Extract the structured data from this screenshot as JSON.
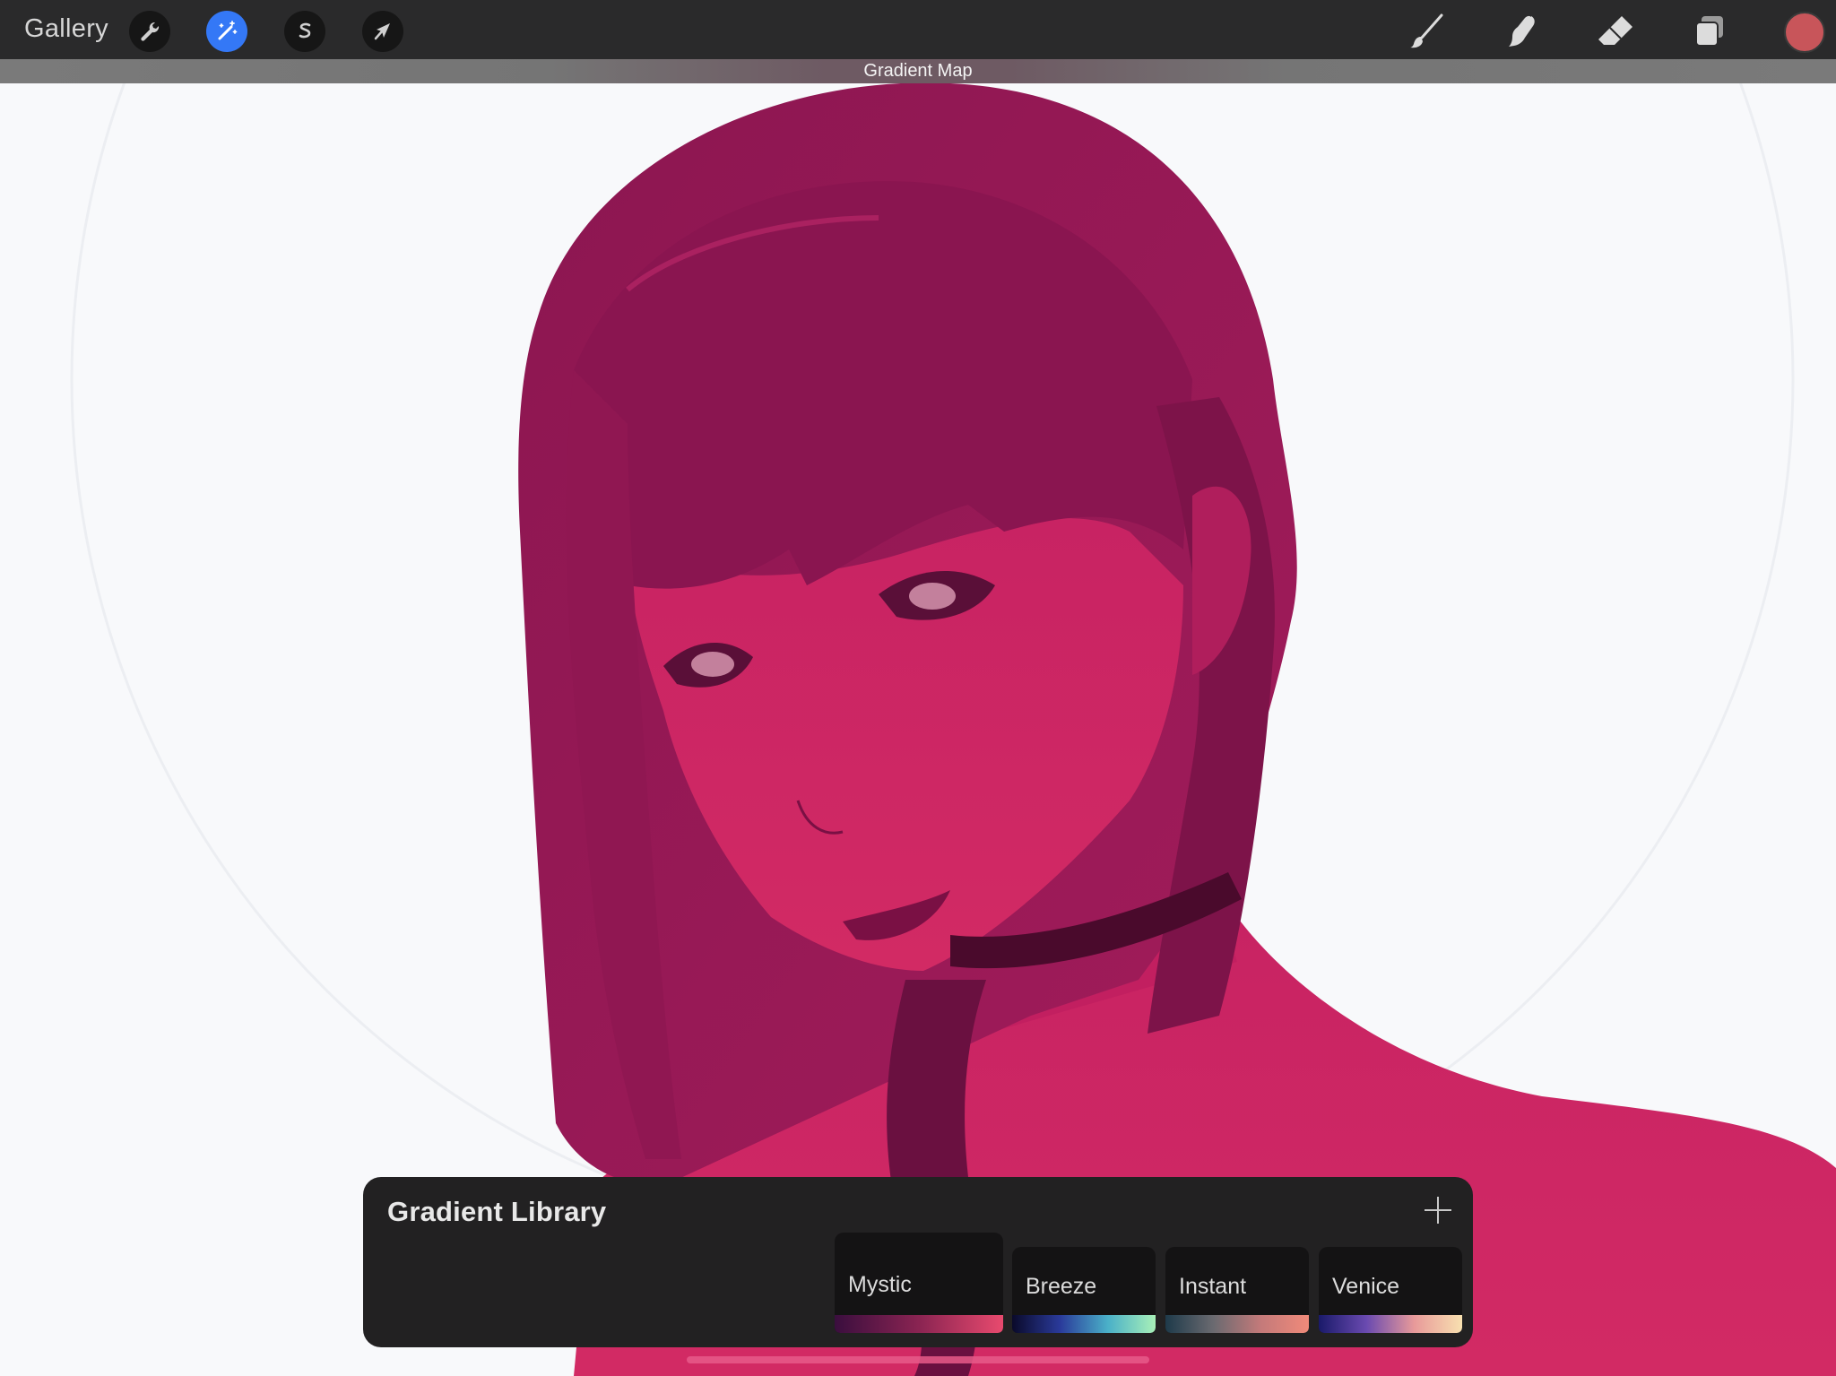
{
  "toolbar": {
    "gallery_label": "Gallery",
    "left_tools": [
      {
        "name": "actions",
        "icon": "wrench-icon"
      },
      {
        "name": "adjustments",
        "icon": "magic-wand-icon",
        "active": true
      },
      {
        "name": "selection",
        "icon": "selection-s-icon"
      },
      {
        "name": "transform",
        "icon": "arrow-cursor-icon"
      }
    ],
    "right_tools": [
      {
        "name": "brush",
        "icon": "brush-icon"
      },
      {
        "name": "smudge",
        "icon": "smudge-finger-icon"
      },
      {
        "name": "eraser",
        "icon": "eraser-icon"
      },
      {
        "name": "layers",
        "icon": "layers-icon"
      }
    ],
    "current_color": "#c8555a"
  },
  "adjustment": {
    "label": "Gradient Map"
  },
  "gradient_library": {
    "title": "Gradient Library",
    "add_icon": "plus-icon",
    "gradients": [
      {
        "name": "Mystic",
        "selected": true,
        "colors": [
          "#3a0e3e",
          "#8a2452",
          "#e84a6e"
        ]
      },
      {
        "name": "Breeze",
        "selected": false,
        "colors": [
          "#0a0a2a",
          "#2a3a9a",
          "#4ab0c8",
          "#a8f0b8"
        ]
      },
      {
        "name": "Instant",
        "selected": false,
        "colors": [
          "#1e3a4a",
          "#6a6a70",
          "#c47a7a",
          "#f08a7a"
        ]
      },
      {
        "name": "Venice",
        "selected": false,
        "colors": [
          "#1a1a6a",
          "#6a4ab0",
          "#e89a9a",
          "#f8e0b0"
        ]
      }
    ]
  }
}
